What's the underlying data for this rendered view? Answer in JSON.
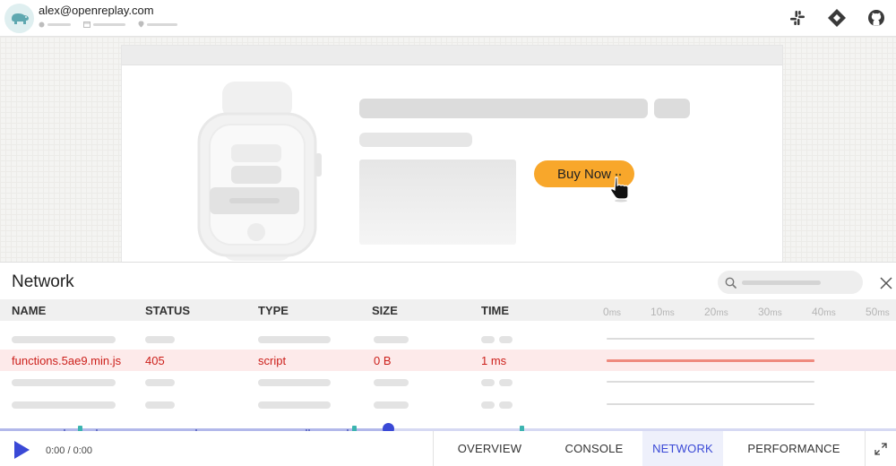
{
  "header": {
    "user_email": "alex@openreplay.com",
    "icons": [
      "slack-icon",
      "jira-icon",
      "github-icon"
    ]
  },
  "stage": {
    "buy_button_label": "Buy Now"
  },
  "network": {
    "title": "Network",
    "columns": [
      "NAME",
      "STATUS",
      "TYPE",
      "SIZE",
      "TIME"
    ],
    "waterfall_ticks": [
      {
        "value": "0",
        "unit": "ms"
      },
      {
        "value": "10",
        "unit": "ms"
      },
      {
        "value": "20",
        "unit": "ms"
      },
      {
        "value": "30",
        "unit": "ms"
      },
      {
        "value": "40",
        "unit": "ms"
      },
      {
        "value": "50",
        "unit": "ms"
      }
    ],
    "error_row": {
      "name": "functions.5ae9.min.js",
      "status": "405",
      "type": "script",
      "size": "0 B",
      "time": "1 ms"
    },
    "colors": {
      "error_text": "#cc1f1a",
      "error_bg": "#fdeaea",
      "accent": "#3a49d6"
    }
  },
  "player": {
    "time": "0:00 / 0:00",
    "tabs": [
      "OVERVIEW",
      "CONSOLE",
      "NETWORK",
      "PERFORMANCE"
    ],
    "active_tab": "NETWORK"
  }
}
